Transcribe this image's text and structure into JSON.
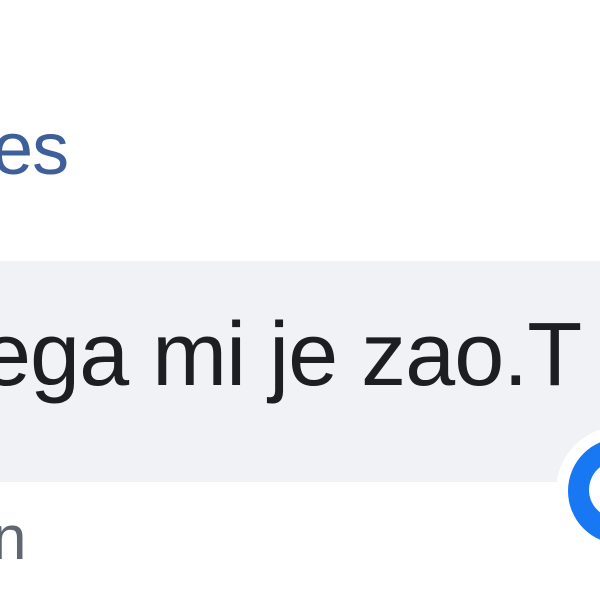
{
  "comment": {
    "author_partial": "es",
    "text_partial": "jega mi je zao.T",
    "meta_partial": "n"
  },
  "badge": {
    "icon": "messenger-icon",
    "color": "#1877f2"
  },
  "colors": {
    "link": "#3f5f9a",
    "bubble": "#f1f2f5",
    "text": "#1c1e21",
    "meta": "#606770"
  }
}
